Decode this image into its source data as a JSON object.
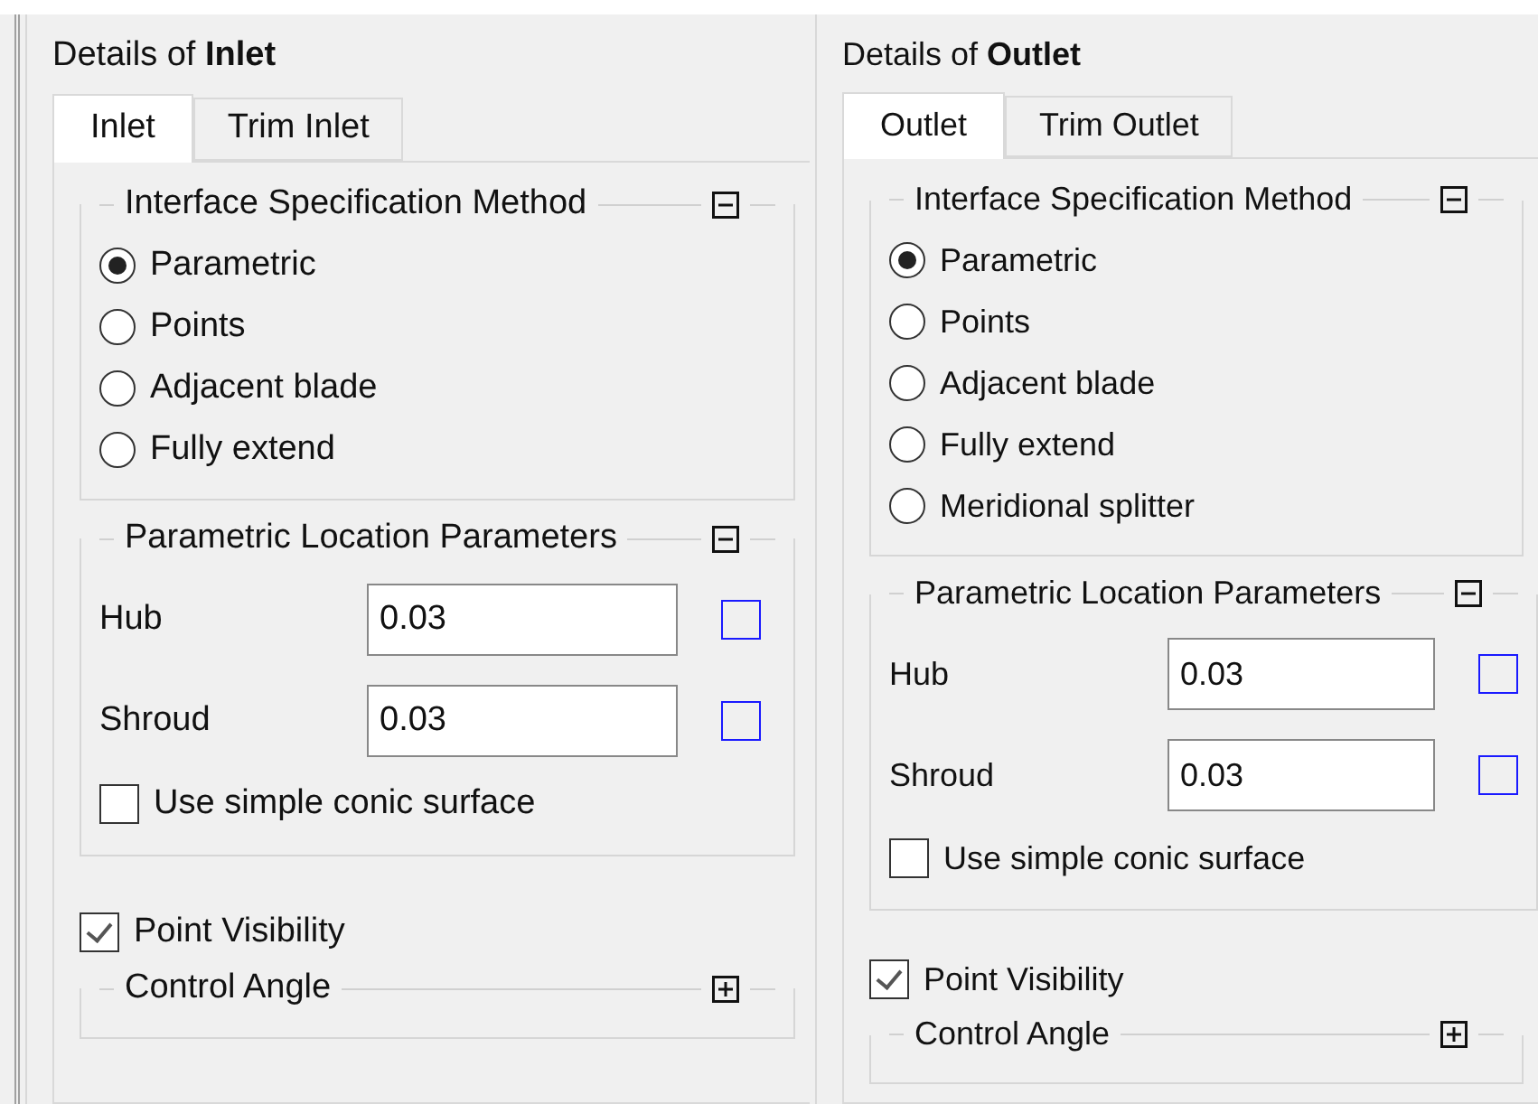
{
  "panels": [
    {
      "title": "Details of **Inlet**",
      "tabs": [
        {
          "label": "Inlet",
          "selected": true
        },
        {
          "label": "Trim Inlet",
          "selected": false
        }
      ],
      "method_group": {
        "title": "Interface Specification Method",
        "expanded": true,
        "options": [
          {
            "label": "Parametric",
            "selected": true
          },
          {
            "label": "Points",
            "selected": false
          },
          {
            "label": "Adjacent blade",
            "selected": false
          },
          {
            "label": "Fully extend",
            "selected": false
          }
        ]
      },
      "location_group": {
        "title": "Parametric Location Parameters",
        "expanded": true,
        "fields": [
          {
            "label": "Hub",
            "value": "0.03",
            "checked": false
          },
          {
            "label": "Shroud",
            "value": "0.03",
            "checked": false
          }
        ],
        "conic": {
          "label": "Use simple conic surface",
          "checked": false
        }
      },
      "point_visibility": {
        "label": "Point Visibility",
        "checked": true
      },
      "control_angle": {
        "title": "Control Angle",
        "expanded": false
      }
    },
    {
      "title": "Details of **Outlet**",
      "tabs": [
        {
          "label": "Outlet",
          "selected": true
        },
        {
          "label": "Trim Outlet",
          "selected": false
        }
      ],
      "method_group": {
        "title": "Interface Specification Method",
        "expanded": true,
        "options": [
          {
            "label": "Parametric",
            "selected": true
          },
          {
            "label": "Points",
            "selected": false
          },
          {
            "label": "Adjacent blade",
            "selected": false
          },
          {
            "label": "Fully extend",
            "selected": false
          },
          {
            "label": "Meridional splitter",
            "selected": false
          }
        ]
      },
      "location_group": {
        "title": "Parametric Location Parameters",
        "expanded": true,
        "fields": [
          {
            "label": "Hub",
            "value": "0.03",
            "checked": false
          },
          {
            "label": "Shroud",
            "value": "0.03",
            "checked": false
          }
        ],
        "conic": {
          "label": "Use simple conic surface",
          "checked": false
        }
      },
      "point_visibility": {
        "label": "Point Visibility",
        "checked": true
      },
      "control_angle": {
        "title": "Control Angle",
        "expanded": false
      }
    }
  ]
}
